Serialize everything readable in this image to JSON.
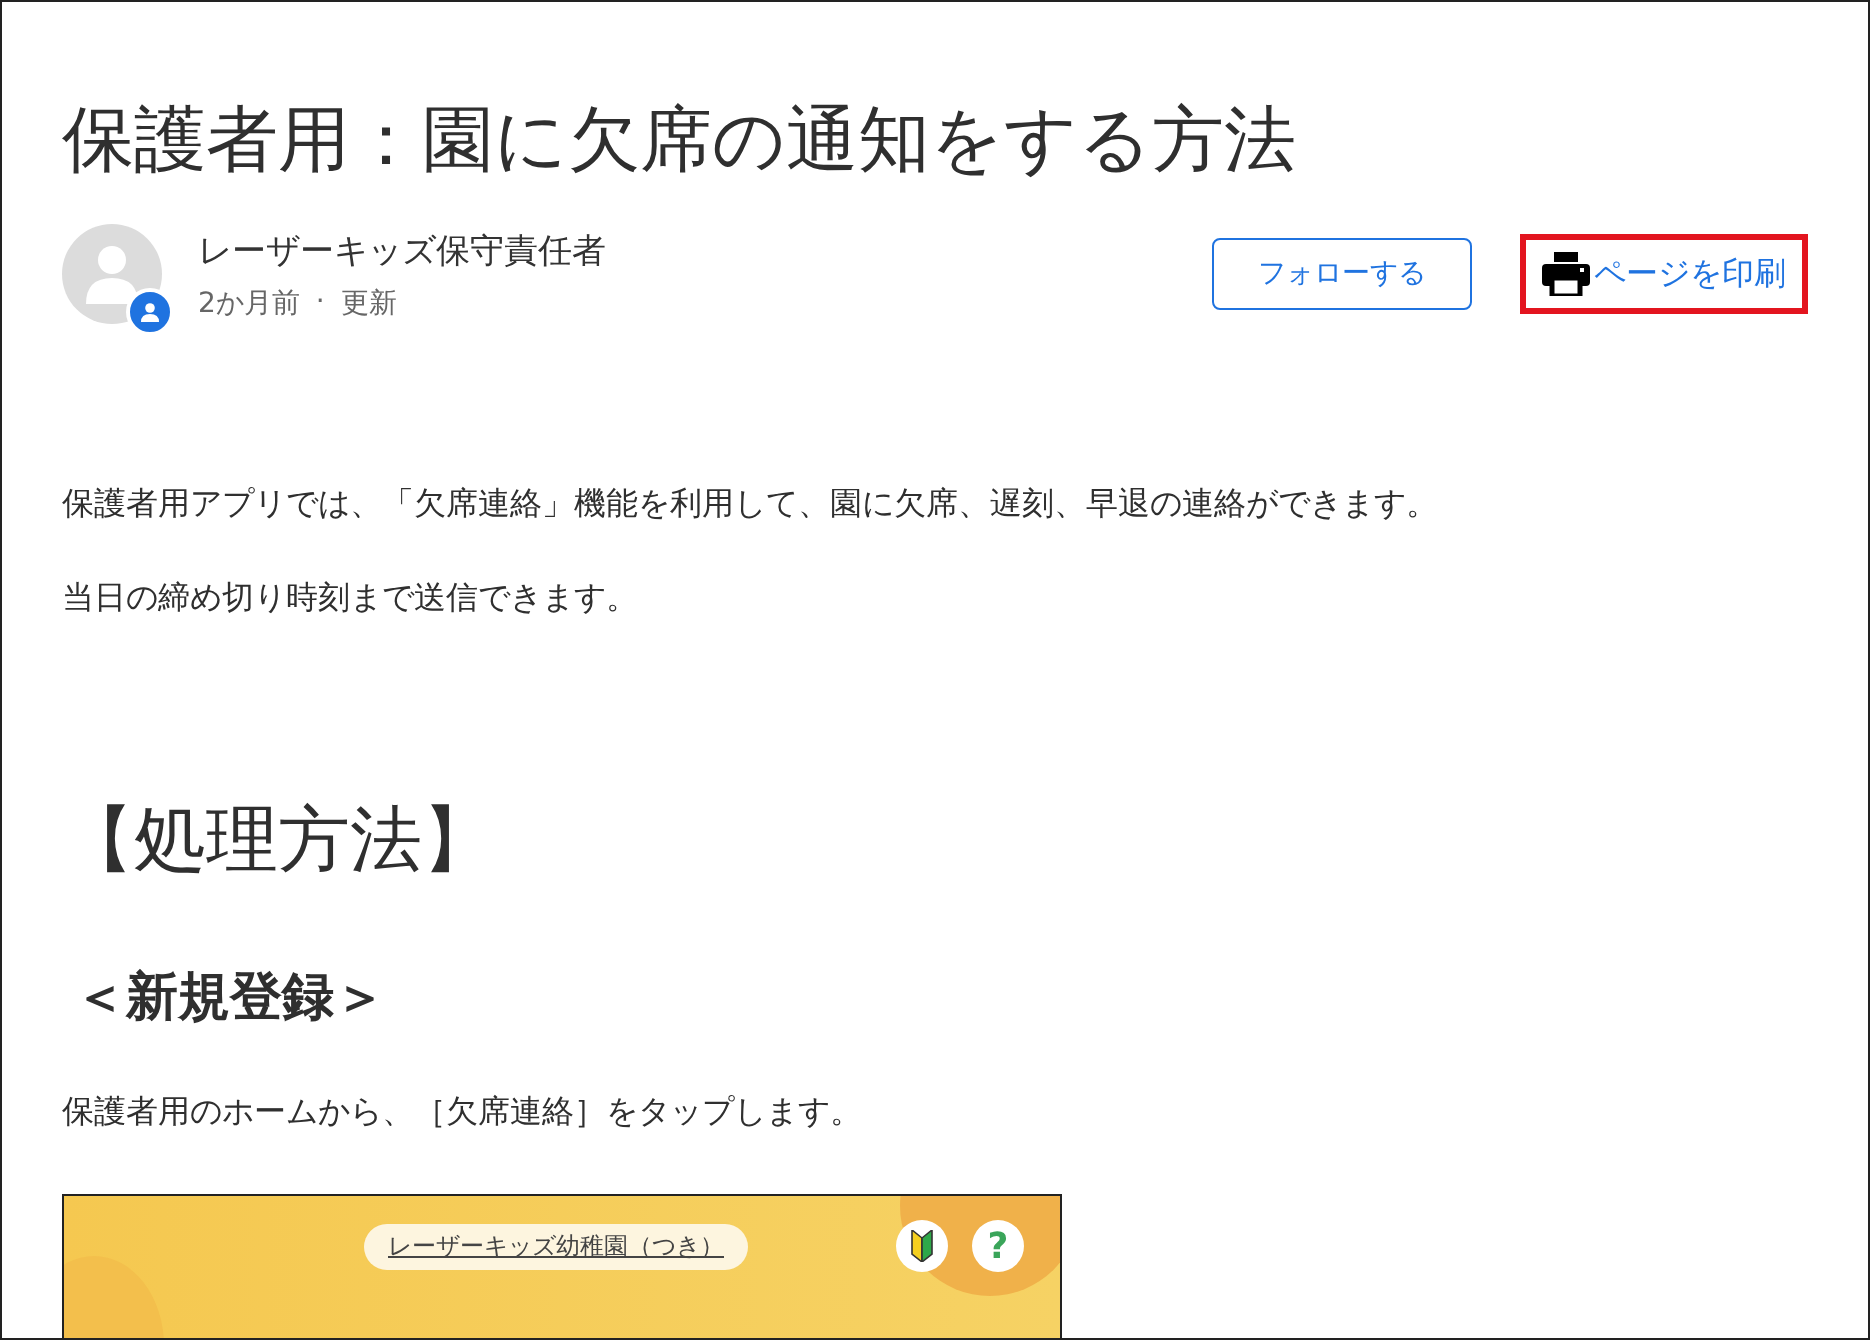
{
  "article": {
    "title": "保護者用：園に欠席の通知をする方法",
    "author": {
      "name": "レーザーキッズ保守責任者",
      "age": "2か月前",
      "separator": "·",
      "updated": "更新"
    },
    "follow_button": "フォローする",
    "print_link": "ページを印刷",
    "paragraphs": [
      "保護者用アプリでは、「欠席連絡」機能を利用して、園に欠席、遅刻、早退の連絡ができます。",
      "当日の締め切り時刻まで送信できます。"
    ],
    "section_heading": "【処理方法】",
    "subheading": "＜新規登録＞",
    "step_text": "保護者用のホームから、［欠席連絡］をタップします。",
    "app_screenshot": {
      "school_name": "レーザーキッズ幼稚園（つき）",
      "help_button": "?"
    }
  }
}
